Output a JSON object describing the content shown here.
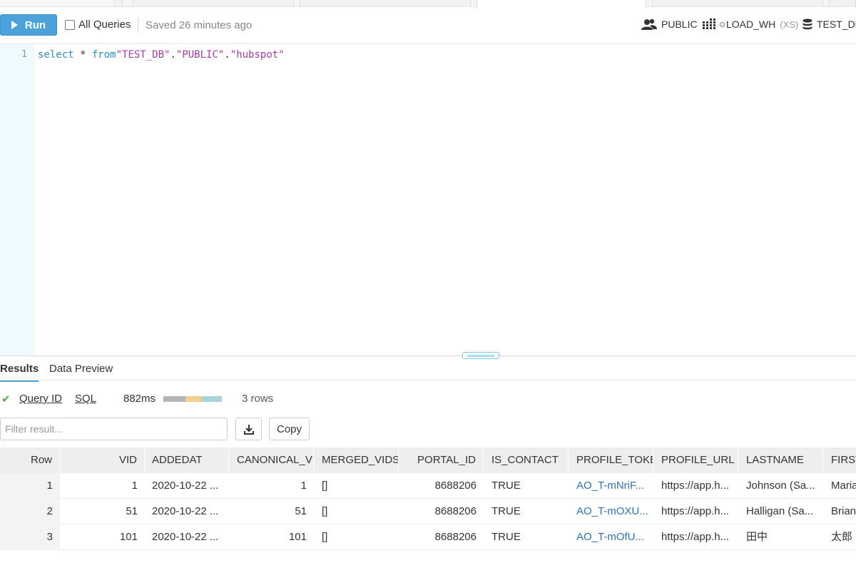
{
  "toolbar": {
    "run_label": "Run",
    "all_queries_label": "All Queries",
    "saved_text": "Saved 26 minutes ago",
    "role": "PUBLIC",
    "warehouse": "LOAD_WH",
    "warehouse_size": "(XS)",
    "database": "TEST_DE"
  },
  "editor": {
    "line_number": "1",
    "tokens": {
      "select": "select",
      "star": " * ",
      "from": "from",
      "db": "\"TEST_DB\"",
      "dot1": ".",
      "schema": "\"PUBLIC\"",
      "dot2": ".",
      "table": "\"hubspot\""
    }
  },
  "results": {
    "tabs": [
      "Results",
      "Data Preview"
    ],
    "query_id_label": "Query ID",
    "sql_label": "SQL",
    "duration": "882ms",
    "rows_count": "3 rows",
    "filter_placeholder": "Filter result...",
    "copy_label": "Copy",
    "bar_colors": [
      "#b4b4b4",
      "#f2cf8f",
      "#a9d3df"
    ],
    "columns": [
      "Row",
      "VID",
      "ADDEDAT",
      "CANONICAL_VID",
      "MERGED_VIDS",
      "PORTAL_ID",
      "IS_CONTACT",
      "PROFILE_TOKEN",
      "PROFILE_URL",
      "LASTNAME",
      "FIRST"
    ],
    "rows": [
      [
        "1",
        "1",
        "2020-10-22 ...",
        "1",
        "[]",
        "8688206",
        "TRUE",
        "AO_T-mNriF...",
        "https://app.h...",
        "Johnson (Sa...",
        "Maria"
      ],
      [
        "2",
        "51",
        "2020-10-22 ...",
        "51",
        "[]",
        "8688206",
        "TRUE",
        "AO_T-mOXU...",
        "https://app.h...",
        "Halligan (Sa...",
        "Brian"
      ],
      [
        "3",
        "101",
        "2020-10-22 ...",
        "101",
        "[]",
        "8688206",
        "TRUE",
        "AO_T-mOfU...",
        "https://app.h...",
        "田中",
        "太郎"
      ]
    ]
  }
}
